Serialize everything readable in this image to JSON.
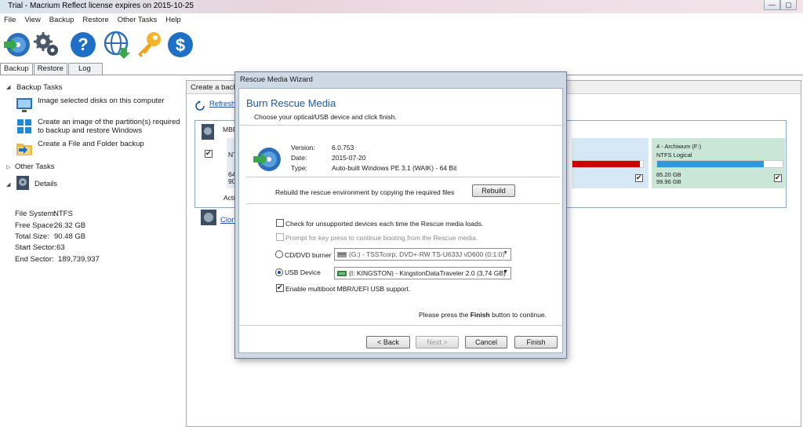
{
  "window": {
    "title": "Trial - Macrium Reflect",
    "license": "license expires on 2015-10-25",
    "buttons": {
      "minimize": "—",
      "maximize": "▢"
    }
  },
  "menu": [
    "File",
    "View",
    "Backup",
    "Restore",
    "Other Tasks",
    "Help"
  ],
  "tabs": [
    "Backup",
    "Restore",
    "Log"
  ],
  "sidebar": {
    "backup_tasks_heading": "Backup Tasks",
    "tasks": [
      {
        "label": "Image selected disks on this computer",
        "icon": "monitor-icon"
      },
      {
        "label": "Create an image of the partition(s) required to backup and restore Windows",
        "icon": "windows-icon"
      },
      {
        "label": "Create a File and Folder backup",
        "icon": "folder-icon"
      }
    ],
    "other_tasks_heading": "Other Tasks",
    "details_heading": "Details",
    "details": [
      {
        "label": "File System:",
        "value": "NTFS"
      },
      {
        "label": "Free Space:",
        "value": "26.32 GB"
      },
      {
        "label": "Total Size:",
        "value": "90.48 GB"
      },
      {
        "label": "Start Sector:",
        "value": "63"
      },
      {
        "label": "End Sector:",
        "value": "189,739,937"
      }
    ]
  },
  "main": {
    "header": "Create a backu",
    "refresh": "Refresh",
    "mbr": "MBR",
    "partition1": {
      "ntf": "NTF",
      "s1": "64",
      "s2": "90",
      "acti": "Acti"
    },
    "partition4": {
      "title": "4 - Archiwum (F:)",
      "type": "NTFS Logical",
      "used": "85.20 GB",
      "total": "99.96 GB",
      "fill_percent": 85
    },
    "partition3_fill_percent": 95,
    "clone": "Clon"
  },
  "dialog": {
    "title": "Rescue Media Wizard",
    "heading": "Burn Rescue Media",
    "subheading": "Choose your optical/USB device and click finish.",
    "version_label": "Version:",
    "version": "6.0.753",
    "date_label": "Date:",
    "date": "2015-07-20",
    "type_label": "Type:",
    "type": "Auto-built Windows PE 3.1 (WAIK) - 64 Bit",
    "rebuild_text": "Rebuild the rescue environment by copying the required files",
    "rebuild_button": "Rebuild",
    "check_unsupported": "Check for unsupported devices each time the Rescue media loads.",
    "prompt_keypress": "Prompt for key press to continue booting from the Rescue media.",
    "cd_label": "CD/DVD burner",
    "cd_value": "(G:) - TSSTcorp, DVD+-RW TS-U633J vD600 (0:1:0)",
    "usb_label": "USB Device",
    "usb_value": "(I: KINGSTON) - KingstonDataTraveler 2.0 (3,74 GB)",
    "multiboot": "Enable multiboot MBR/UEFI USB support.",
    "finish_note_pre": "Please press the ",
    "finish_note_bold": "Finish",
    "finish_note_post": " button to continue.",
    "back": "< Back",
    "next": "Next >",
    "cancel": "Cancel",
    "finish": "Finish"
  },
  "colors": {
    "accent_blue": "#1e73c8",
    "link": "#1a53a8",
    "partition_red": "#cc0000",
    "partition_green": "#c9e6d6",
    "partition_blue_bar": "#2f9ad6"
  }
}
